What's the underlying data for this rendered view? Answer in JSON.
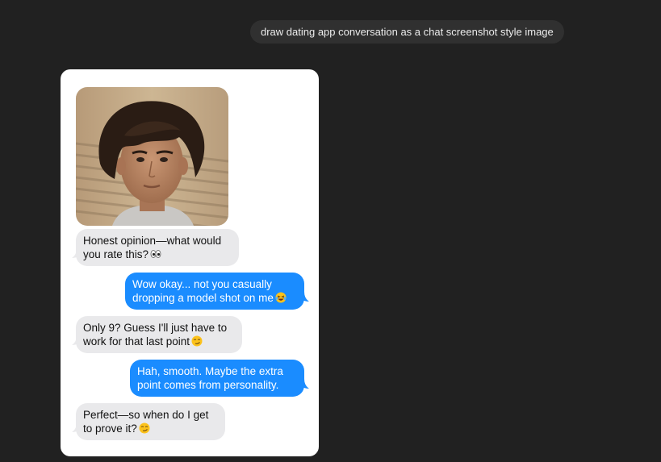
{
  "prompt": {
    "text": "draw dating app conversation as a chat screenshot style image"
  },
  "chat": {
    "messages": [
      {
        "side": "incoming",
        "lines": [
          "Honest opinion—what would",
          "you rate this?"
        ],
        "emoji": "eyes-emoji"
      },
      {
        "side": "outgoing",
        "lines": [
          "Wow okay... not you casually",
          "dropping a model shot on me"
        ],
        "emoji": "laughing-emoji"
      },
      {
        "side": "incoming",
        "lines": [
          "Only 9? Guess I'll just have to",
          "work for that last point"
        ],
        "emoji": "smirk-emoji"
      },
      {
        "side": "outgoing",
        "lines": [
          "Hah, smooth. Maybe the extra",
          "point comes from personality."
        ],
        "emoji": ""
      },
      {
        "side": "incoming",
        "lines": [
          "Perfect—so when do I get",
          "to prove it?"
        ],
        "emoji": "smirk-emoji"
      }
    ]
  },
  "colors": {
    "background": "#212121",
    "prompt_bubble": "#303030",
    "incoming_bubble": "#e9e9eb",
    "outgoing_bubble": "#1a8cff"
  }
}
